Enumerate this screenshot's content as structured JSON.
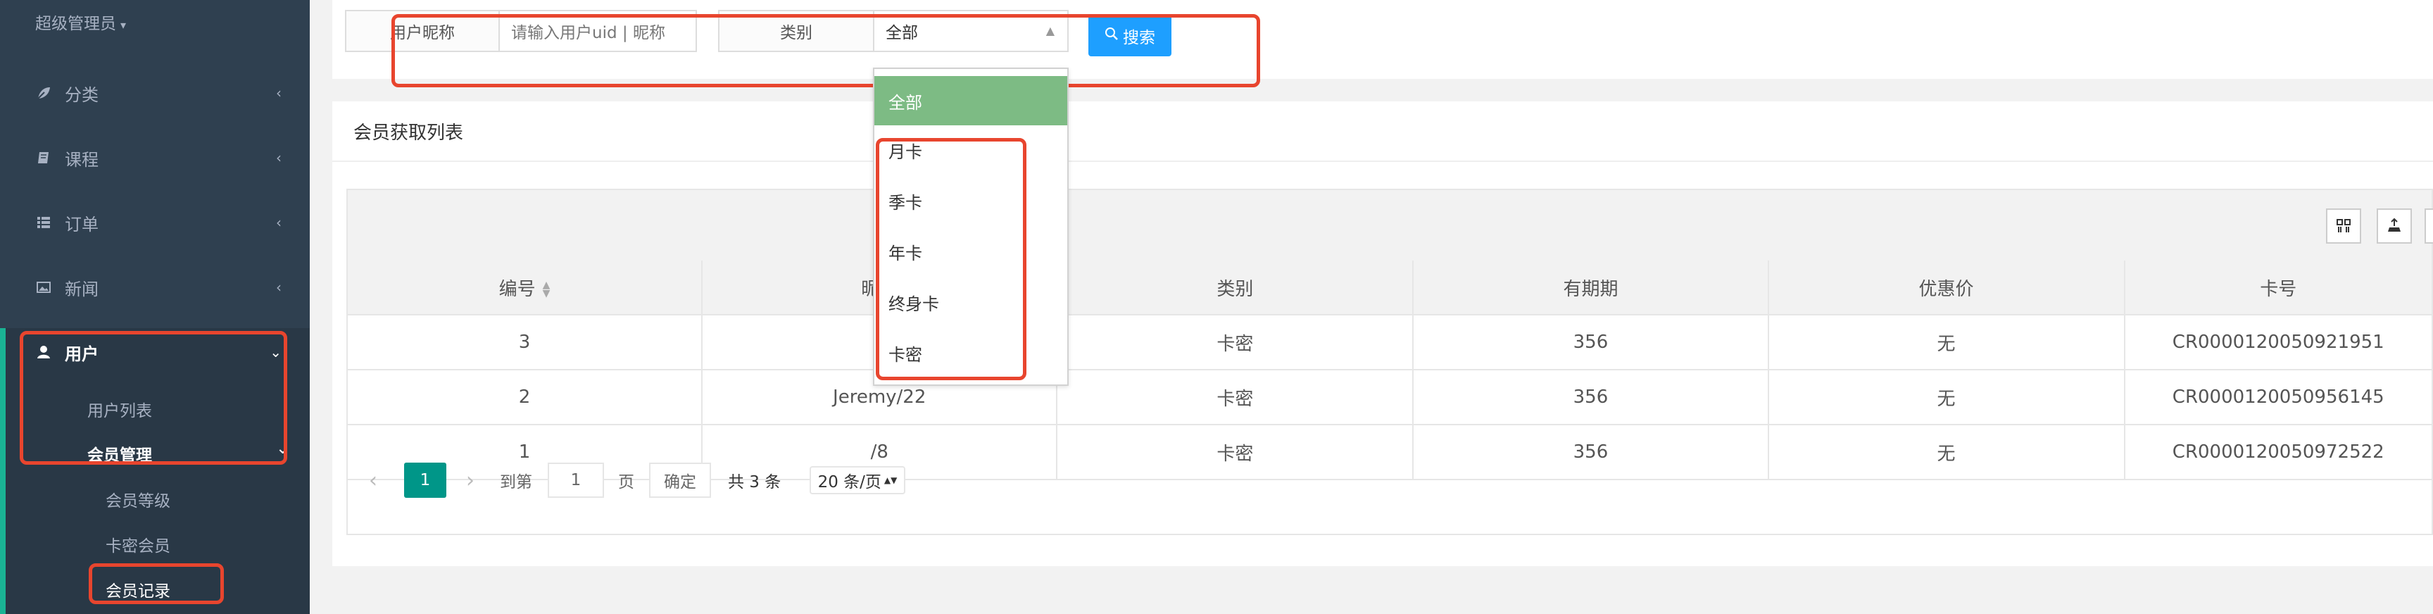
{
  "sidebar": {
    "role": "超级管理员",
    "nav": [
      {
        "label": "分类",
        "icon": "leaf-icon"
      },
      {
        "label": "课程",
        "icon": "book-icon"
      },
      {
        "label": "订单",
        "icon": "list-icon"
      },
      {
        "label": "新闻",
        "icon": "image-icon"
      },
      {
        "label": "用户",
        "icon": "user-icon"
      }
    ],
    "user_list": "用户列表",
    "member_manage": "会员管理",
    "member_level": "会员等级",
    "card_member": "卡密会员",
    "member_record": "会员记录"
  },
  "search": {
    "nickname_label": "用户昵称",
    "nickname_placeholder": "请输入用户uid | 昵称",
    "category_label": "类别",
    "category_value": "全部",
    "button": "搜索"
  },
  "dropdown": {
    "options": [
      "全部",
      "月卡",
      "季卡",
      "年卡",
      "终身卡",
      "卡密"
    ],
    "selected": "全部"
  },
  "panel": {
    "title": "会员获取列表"
  },
  "table": {
    "headers": [
      "编号",
      "昵称",
      "类别",
      "有期期",
      "优惠价",
      "卡号"
    ],
    "rows": [
      [
        "3",
        "/",
        "卡密",
        "356",
        "无",
        "CR0000120050921951"
      ],
      [
        "2",
        "Jeremy/22",
        "卡密",
        "356",
        "无",
        "CR0000120050956145"
      ],
      [
        "1",
        "/8",
        "卡密",
        "356",
        "无",
        "CR0000120050972522"
      ]
    ]
  },
  "pager": {
    "current": "1",
    "goto_label": "到第",
    "page_input": "1",
    "page_unit": "页",
    "confirm": "确定",
    "total": "共 3 条",
    "page_size": "20 条/页"
  },
  "colors": {
    "sidebar": "#2f4050",
    "accent": "#1ab394",
    "primary": "#1e9fff",
    "highlight": "#e8452e",
    "selected_option": "#7dbb84",
    "page_current": "#009688"
  }
}
